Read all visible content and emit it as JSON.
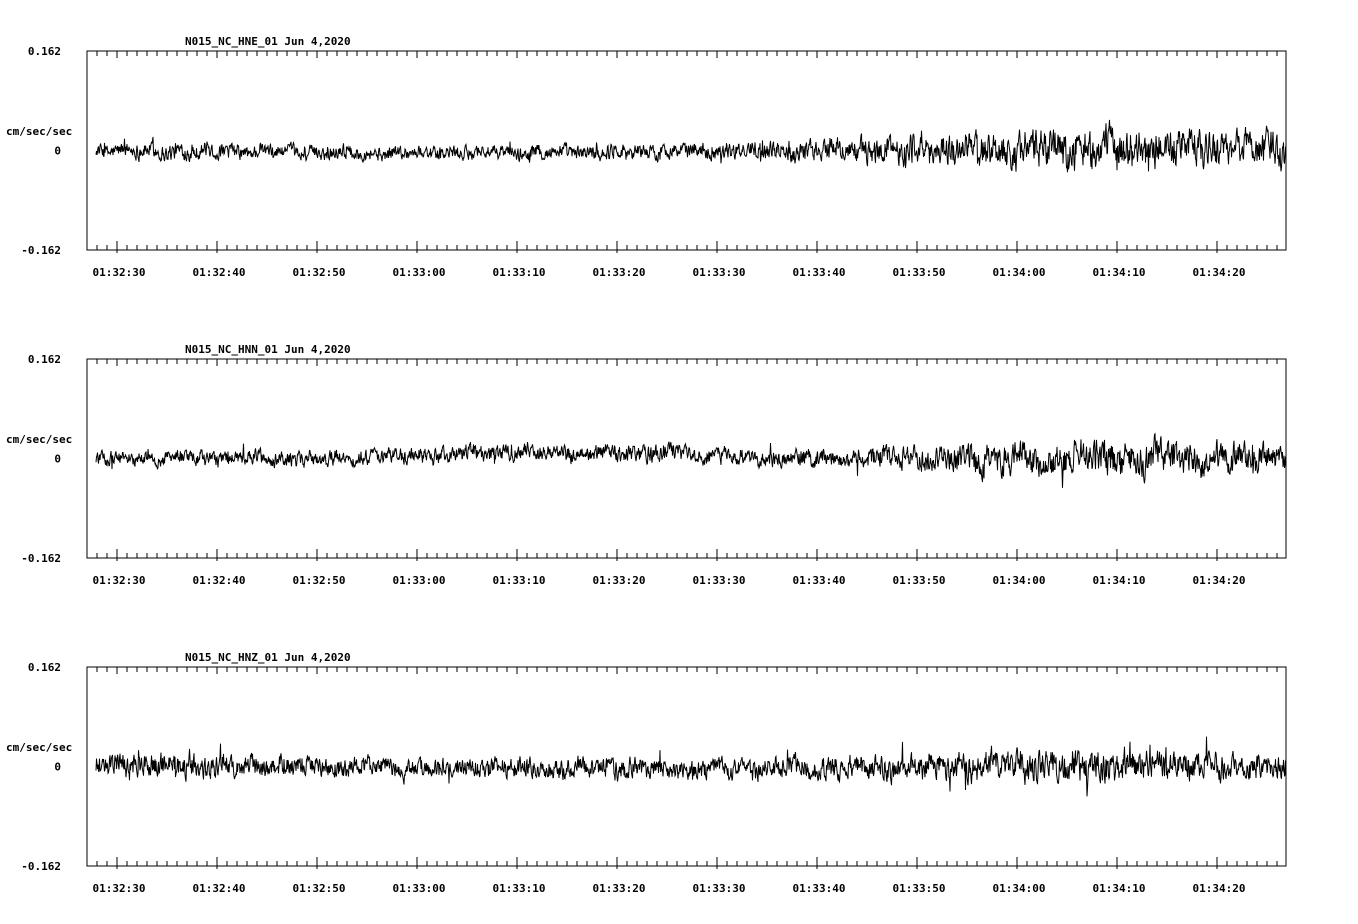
{
  "chart_data": [
    {
      "type": "line",
      "title": "N015_NC_HNE_01   Jun 4,2020",
      "ylabel": "cm/sec/sec",
      "ylim": [
        -0.162,
        0.162
      ],
      "y_ticks": [
        "0.162",
        "0",
        "-0.162"
      ],
      "x_ticks": [
        "01:32:30",
        "01:32:40",
        "01:32:50",
        "01:33:00",
        "01:33:10",
        "01:33:20",
        "01:33:30",
        "01:33:40",
        "01:33:50",
        "01:34:00",
        "01:34:10",
        "01:34:20"
      ],
      "xlim_seconds_after_01_32_30": [
        -3,
        117
      ],
      "envelope": [
        {
          "t": -2,
          "a": 0.012
        },
        {
          "t": 5,
          "a": 0.015
        },
        {
          "t": 15,
          "a": 0.013
        },
        {
          "t": 25,
          "a": 0.012
        },
        {
          "t": 35,
          "a": 0.012
        },
        {
          "t": 45,
          "a": 0.013
        },
        {
          "t": 55,
          "a": 0.013
        },
        {
          "t": 65,
          "a": 0.015
        },
        {
          "t": 72,
          "a": 0.02
        },
        {
          "t": 80,
          "a": 0.025
        },
        {
          "t": 88,
          "a": 0.03
        },
        {
          "t": 96,
          "a": 0.035
        },
        {
          "t": 105,
          "a": 0.033
        },
        {
          "t": 116,
          "a": 0.03
        }
      ],
      "baseline_drift": [
        {
          "t": -2,
          "v": 0.0
        },
        {
          "t": 26,
          "v": -0.004
        },
        {
          "t": 45,
          "v": -0.003
        },
        {
          "t": 60,
          "v": 0.0
        },
        {
          "t": 116,
          "v": 0.004
        }
      ]
    },
    {
      "type": "line",
      "title": "N015_NC_HNN_01   Jun 4,2020",
      "ylabel": "cm/sec/sec",
      "ylim": [
        -0.162,
        0.162
      ],
      "y_ticks": [
        "0.162",
        "0",
        "-0.162"
      ],
      "x_ticks": [
        "01:32:30",
        "01:32:40",
        "01:32:50",
        "01:33:00",
        "01:33:10",
        "01:33:20",
        "01:33:30",
        "01:33:40",
        "01:33:50",
        "01:34:00",
        "01:34:10",
        "01:34:20"
      ],
      "xlim_seconds_after_01_32_30": [
        -3,
        117
      ],
      "envelope": [
        {
          "t": -2,
          "a": 0.012
        },
        {
          "t": 10,
          "a": 0.013
        },
        {
          "t": 25,
          "a": 0.013
        },
        {
          "t": 40,
          "a": 0.015
        },
        {
          "t": 50,
          "a": 0.016
        },
        {
          "t": 60,
          "a": 0.014
        },
        {
          "t": 70,
          "a": 0.015
        },
        {
          "t": 80,
          "a": 0.02
        },
        {
          "t": 90,
          "a": 0.028
        },
        {
          "t": 100,
          "a": 0.03
        },
        {
          "t": 110,
          "a": 0.028
        },
        {
          "t": 116,
          "a": 0.025
        }
      ],
      "baseline_drift": [
        {
          "t": -2,
          "v": 0.0
        },
        {
          "t": 20,
          "v": 0.0
        },
        {
          "t": 40,
          "v": 0.01
        },
        {
          "t": 55,
          "v": 0.01
        },
        {
          "t": 65,
          "v": 0.0
        },
        {
          "t": 116,
          "v": 0.0
        }
      ]
    },
    {
      "type": "line",
      "title": "N015_NC_HNZ_01   Jun 4,2020",
      "ylabel": "cm/sec/sec",
      "ylim": [
        -0.162,
        0.162
      ],
      "y_ticks": [
        "0.162",
        "0",
        "-0.162"
      ],
      "x_ticks": [
        "01:32:30",
        "01:32:40",
        "01:32:50",
        "01:33:00",
        "01:33:10",
        "01:33:20",
        "01:33:30",
        "01:33:40",
        "01:33:50",
        "01:34:00",
        "01:34:10",
        "01:34:20"
      ],
      "xlim_seconds_after_01_32_30": [
        -3,
        117
      ],
      "envelope": [
        {
          "t": -2,
          "a": 0.02
        },
        {
          "t": 5,
          "a": 0.022
        },
        {
          "t": 15,
          "a": 0.018
        },
        {
          "t": 30,
          "a": 0.017
        },
        {
          "t": 45,
          "a": 0.018
        },
        {
          "t": 60,
          "a": 0.017
        },
        {
          "t": 75,
          "a": 0.02
        },
        {
          "t": 85,
          "a": 0.025
        },
        {
          "t": 95,
          "a": 0.028
        },
        {
          "t": 105,
          "a": 0.025
        },
        {
          "t": 116,
          "a": 0.022
        }
      ],
      "baseline_drift": [
        {
          "t": -2,
          "v": 0.003
        },
        {
          "t": 30,
          "v": -0.002
        },
        {
          "t": 60,
          "v": -0.004
        },
        {
          "t": 90,
          "v": 0.002
        },
        {
          "t": 116,
          "v": 0.0
        }
      ]
    }
  ]
}
